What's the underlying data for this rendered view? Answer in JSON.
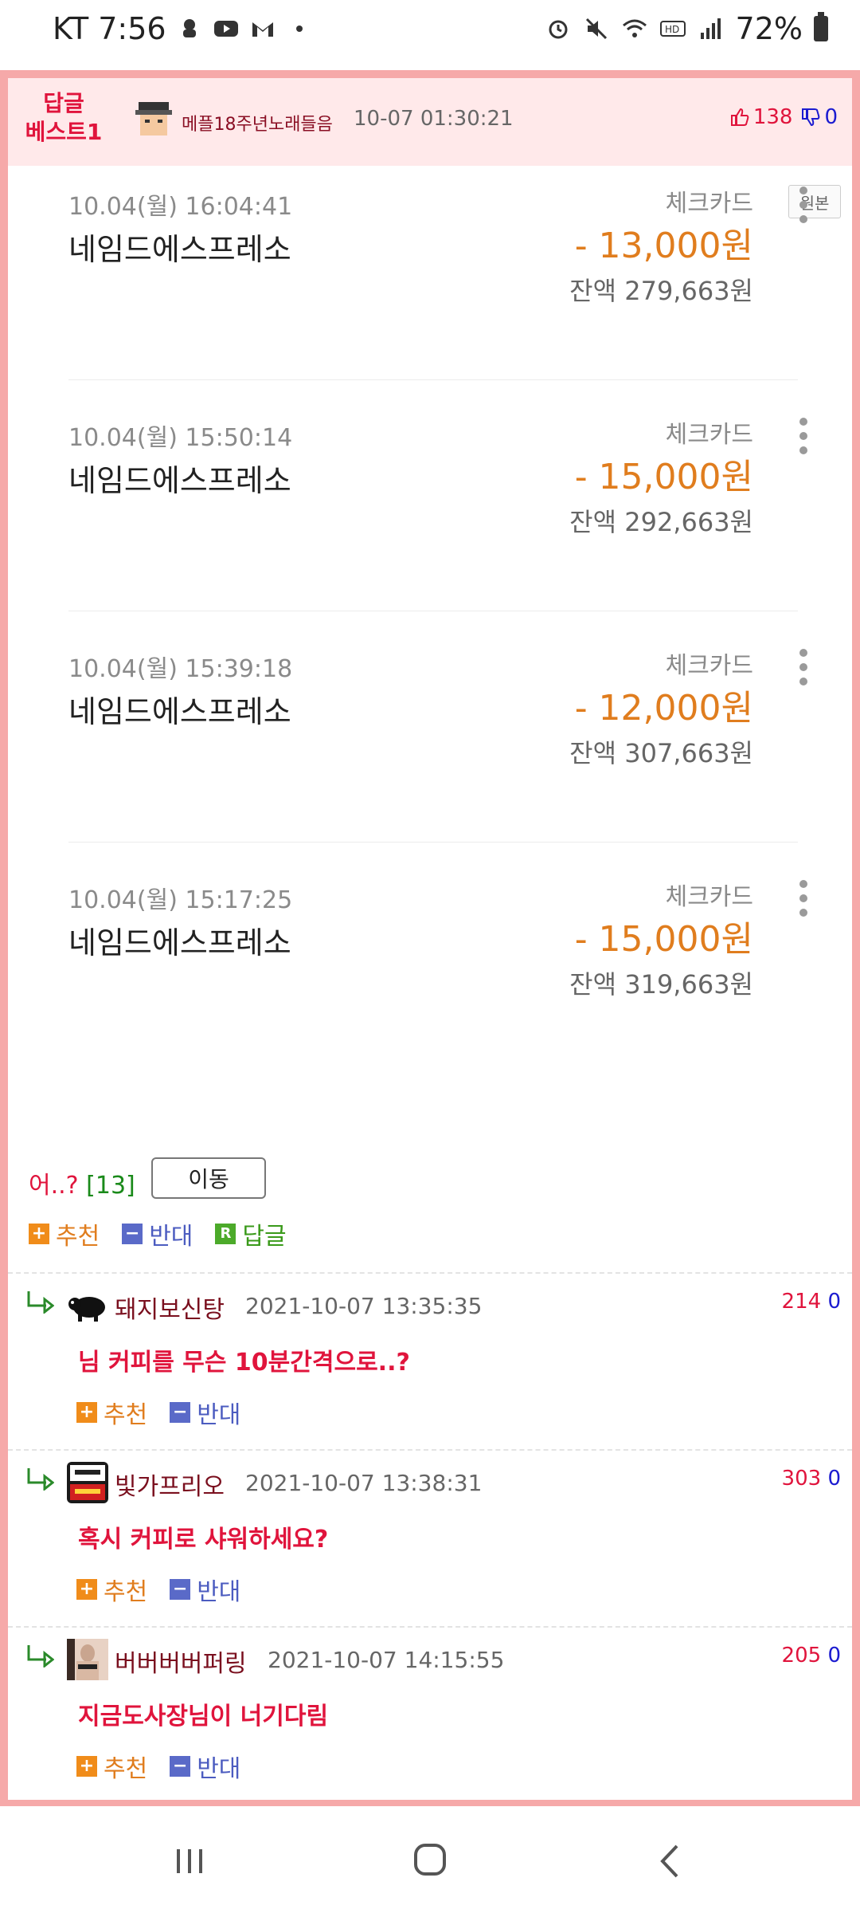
{
  "status": {
    "carrier_time": "KT 7:56",
    "battery": "72%"
  },
  "post": {
    "badge_line1": "답글",
    "badge_line2": "베스트1",
    "nickname": "메플18주년노래들음",
    "datetime": "10-07 01:30:21",
    "up": "138",
    "down": "0",
    "original_label": "원본"
  },
  "transactions": [
    {
      "datetime": "10.04(월) 16:04:41",
      "merchant": "네임드에스프레소",
      "card": "체크카드",
      "amount": "- 13,000원",
      "balance": "잔액  279,663원"
    },
    {
      "datetime": "10.04(월) 15:50:14",
      "merchant": "네임드에스프레소",
      "card": "체크카드",
      "amount": "- 15,000원",
      "balance": "잔액  292,663원"
    },
    {
      "datetime": "10.04(월) 15:39:18",
      "merchant": "네임드에스프레소",
      "card": "체크카드",
      "amount": "- 12,000원",
      "balance": "잔액  307,663원"
    },
    {
      "datetime": "10.04(월) 15:17:25",
      "merchant": "네임드에스프레소",
      "card": "체크카드",
      "amount": "- 15,000원",
      "balance": "잔액  319,663원"
    }
  ],
  "thread": {
    "title": "어..?",
    "count": "[13]",
    "move_label": "이동"
  },
  "actions": {
    "recommend": "추천",
    "oppose": "반대",
    "reply": "답글",
    "reply_icon": "R"
  },
  "comments": [
    {
      "nickname": "돼지보신탕",
      "datetime": "2021-10-07 13:35:35",
      "up": "214",
      "down": "0",
      "text": "님 커피를 무슨 10분간격으로..?"
    },
    {
      "nickname": "빛가프리오",
      "datetime": "2021-10-07 13:38:31",
      "up": "303",
      "down": "0",
      "text": "혹시 커피로 샤워하세요?"
    },
    {
      "nickname": "버버버버퍼링",
      "datetime": "2021-10-07 14:15:55",
      "up": "205",
      "down": "0",
      "text": "지금도사장님이 너기다림"
    }
  ],
  "icons": {
    "thumb_up": "thumbs-up-icon",
    "thumb_down": "thumbs-down-icon",
    "more": "more-vertical-icon",
    "reply_arrow": "reply-arrow-icon"
  }
}
